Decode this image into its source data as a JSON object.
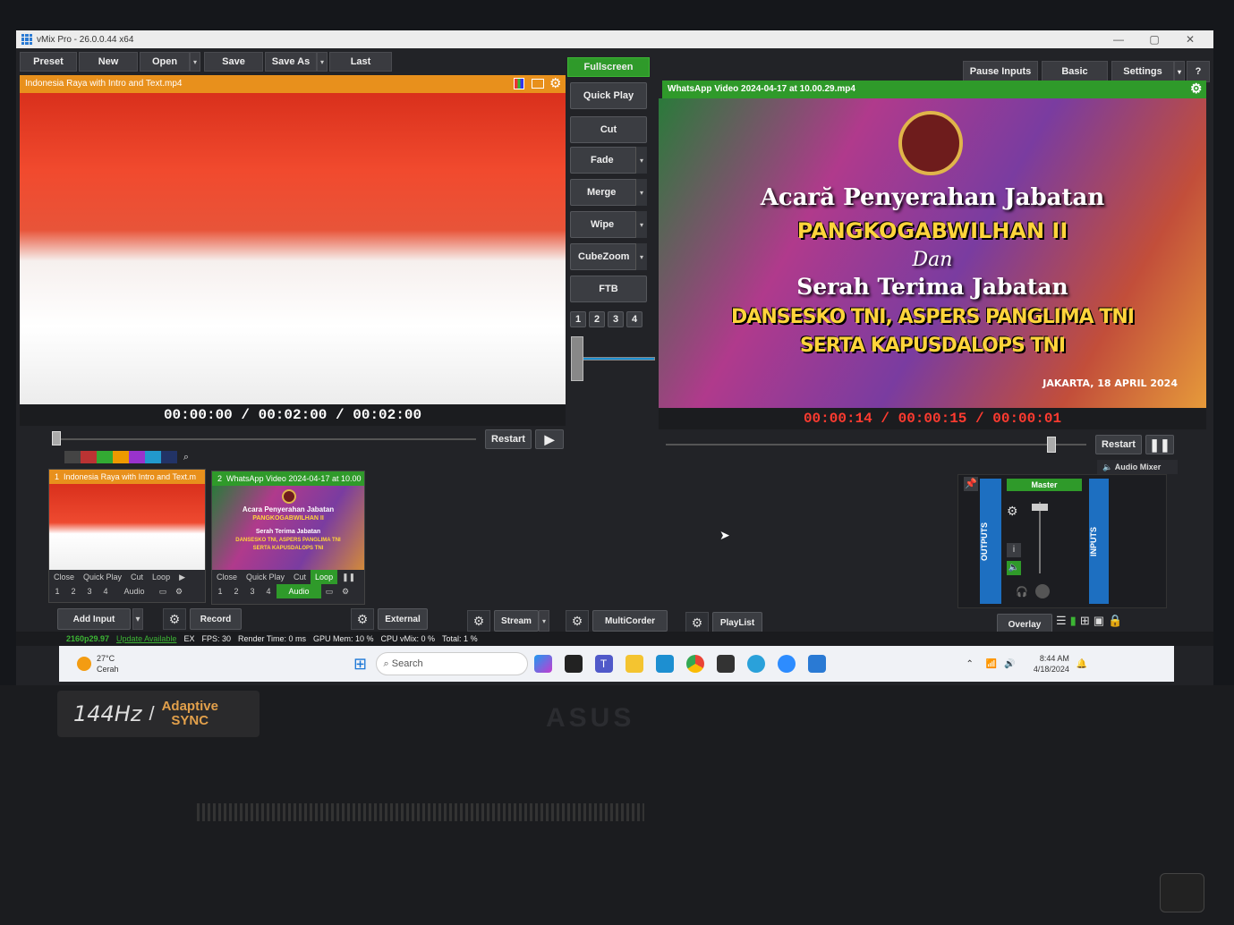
{
  "window": {
    "title": "vMix Pro - 26.0.0.44 x64",
    "controls": [
      "—",
      "▢",
      "✕"
    ]
  },
  "menu": {
    "preset": "Preset",
    "new": "New",
    "open": "Open",
    "save": "Save",
    "save_as": "Save As",
    "last": "Last",
    "fullscreen": "Fullscreen",
    "pause_inputs": "Pause Inputs",
    "basic": "Basic",
    "settings": "Settings",
    "help": "?"
  },
  "preview": {
    "title": "Indonesia Raya with Intro and Text.mp4",
    "time": "00:00:00",
    "duration": "00:02:00",
    "remaining": "00:02:00",
    "sep": "/",
    "restart": "Restart"
  },
  "output": {
    "title": "WhatsApp Video 2024-04-17 at 10.00.29.mp4",
    "time": "00:00:14",
    "duration": "00:00:15",
    "remaining": "00:00:01",
    "sep": "/",
    "restart": "Restart"
  },
  "slide": {
    "line1": "Acară Penyerahan Jabatan",
    "line2": "PANGKOGABWILHAN II",
    "line3": "Dan",
    "line4": "Serah Terima Jabatan",
    "line5": "DANSESKO TNI, ASPERS PANGLIMA TNI",
    "line6": "SERTA KAPUSDALOPS TNI",
    "date": "JAKARTA, 18 APRIL 2024"
  },
  "transitions": {
    "quick_play": "Quick Play",
    "cut": "Cut",
    "fade": "Fade",
    "merge": "Merge",
    "wipe": "Wipe",
    "cubezoom": "CubeZoom",
    "ftb": "FTB",
    "numbers": [
      "1",
      "2",
      "3",
      "4"
    ]
  },
  "inputs": [
    {
      "number": "1",
      "title": "Indonesia Raya with Intro and Text.m",
      "buttons": [
        "Close",
        "Quick Play",
        "Cut",
        "Loop"
      ],
      "nums": [
        "1",
        "2",
        "3",
        "4"
      ],
      "audio": "Audio"
    },
    {
      "number": "2",
      "title": "WhatsApp Video 2024-04-17 at 10.00",
      "buttons": [
        "Close",
        "Quick Play",
        "Cut",
        "Loop"
      ],
      "nums": [
        "1",
        "2",
        "3",
        "4"
      ],
      "audio": "Audio"
    }
  ],
  "thumb2": {
    "l1": "Acara Penyerahan Jabatan",
    "l2": "PANGKOGABWILHAN II",
    "l3": "Serah Terima Jabatan",
    "l4": "DANSESKO TNI, ASPERS PANGLIMA TNI",
    "l5": "SERTA KAPUSDALOPS TNI"
  },
  "audio_mixer": {
    "label": "Audio Mixer",
    "master": "Master",
    "outputs": "OUTPUTS",
    "inputs": "INPUTS",
    "info": "i"
  },
  "bottom": {
    "add_input": "Add Input",
    "record": "Record",
    "external": "External",
    "stream": "Stream",
    "multicorder": "MultiCorder",
    "playlist": "PlayList",
    "overlay": "Overlay"
  },
  "status": {
    "format": "2160p29.97",
    "update": "Update Available",
    "ex": "EX",
    "fps": "FPS: 30",
    "render": "Render Time: 0 ms",
    "gpu": "GPU Mem: 10 %",
    "cpu": "CPU vMix: 0 %",
    "total": "Total: 1 %"
  },
  "taskbar": {
    "temp": "27°C",
    "weather": "Cerah",
    "search": "Search",
    "time": "8:44 AM",
    "date": "4/18/2024"
  },
  "laptop": {
    "hz": "144Hz",
    "adaptive": "Adaptive",
    "sync": "SYNC",
    "brand": "ASUS"
  },
  "colors": {
    "accent_green": "#2f9a2a",
    "accent_orange": "#e8901c",
    "time_red": "#ff3b30"
  }
}
